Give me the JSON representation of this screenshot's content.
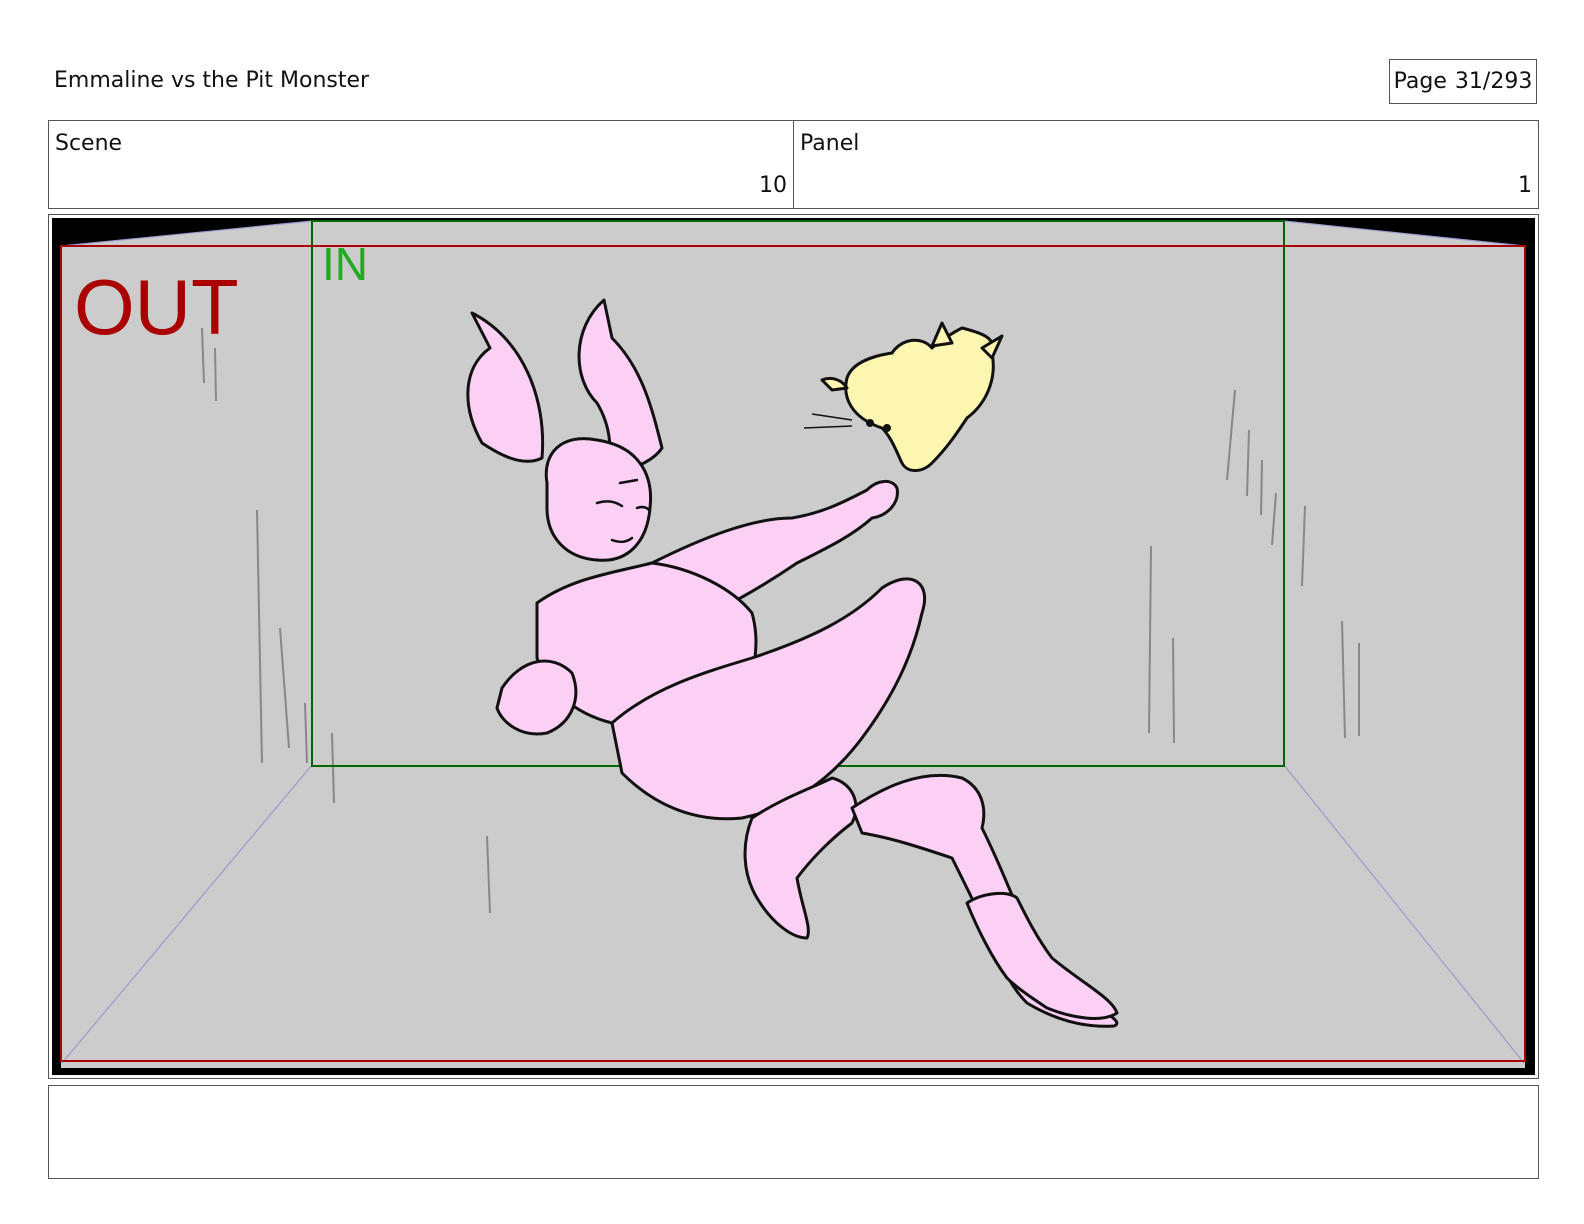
{
  "header": {
    "title": "Emmaline vs the Pit Monster",
    "page_label": "Page",
    "page_number": "31/293"
  },
  "info": {
    "scene_label": "Scene",
    "scene_value": "10",
    "panel_label": "Panel",
    "panel_value": "1"
  },
  "panel": {
    "out_label": "OUT",
    "in_label": "IN",
    "colors": {
      "background": "#cccccc",
      "out_frame": "#aa0000",
      "in_frame": "#006600",
      "in_text": "#22aa22",
      "character_fill": "#fbd0f4",
      "cat_fill": "#fdf6b0",
      "perspective_lines": "#9a9ad0",
      "letterbox": "#000000"
    }
  },
  "notes": {
    "text": ""
  }
}
